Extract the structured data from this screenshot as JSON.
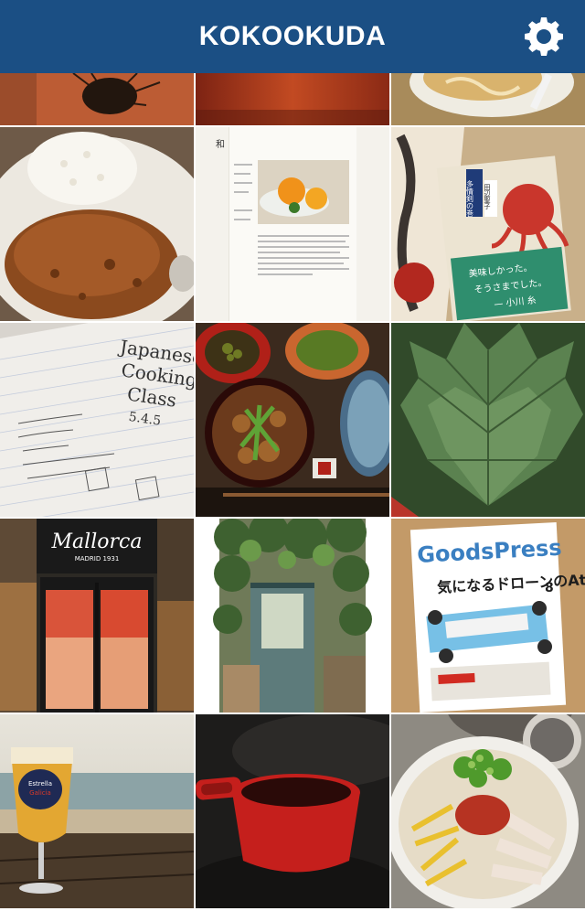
{
  "header": {
    "title": "KOKOOKUDA",
    "settings_icon": "gear-icon",
    "background": "#1b4f84"
  },
  "photos": [
    {
      "name": "photo-sea-urchin",
      "dominant_color": "#b5532e"
    },
    {
      "name": "photo-red-wood-table",
      "dominant_color": "#a3331c"
    },
    {
      "name": "photo-noodle-plate",
      "dominant_color": "#d9c9a1"
    },
    {
      "name": "photo-curry-rice",
      "dominant_color": "#8e4a1f"
    },
    {
      "name": "photo-website-screenshot",
      "dominant_color": "#efece4"
    },
    {
      "name": "photo-japanese-book",
      "dominant_color": "#d8b78d"
    },
    {
      "name": "photo-cooking-class-notes",
      "dominant_color": "#e4e1dc"
    },
    {
      "name": "photo-gyudon-set",
      "dominant_color": "#3a2418"
    },
    {
      "name": "photo-fig-leaf",
      "dominant_color": "#5b7d4a"
    },
    {
      "name": "photo-mallorca-storefront",
      "dominant_color": "#2a2622"
    },
    {
      "name": "photo-ivy-shop-door",
      "dominant_color": "#4f6a3f"
    },
    {
      "name": "photo-goodspress-magazine",
      "dominant_color": "#c9a77a"
    },
    {
      "name": "photo-beer-glass-beach",
      "dominant_color": "#d6a23c"
    },
    {
      "name": "photo-red-cup",
      "dominant_color": "#1a1818"
    },
    {
      "name": "photo-hiyashi-chuka",
      "dominant_color": "#d8d2c4"
    }
  ],
  "visible_text": {
    "cooking_notes": [
      "Japanese",
      "Cooking",
      "Class",
      "5.4.5"
    ],
    "book_title": "多情剣の巻",
    "book_author": "田辺聖子",
    "book_blurb": [
      "美味しかった。",
      "そうさまでした。",
      "— 小川 糸"
    ],
    "store_name": "Mallorca",
    "store_since": "MADRID 1931",
    "magazine_name": "GoodsPress",
    "magazine_issue": "8",
    "magazine_headline": "気になるドローンのAtoZ",
    "beer_brand": [
      "Estrella",
      "Galicia"
    ]
  }
}
